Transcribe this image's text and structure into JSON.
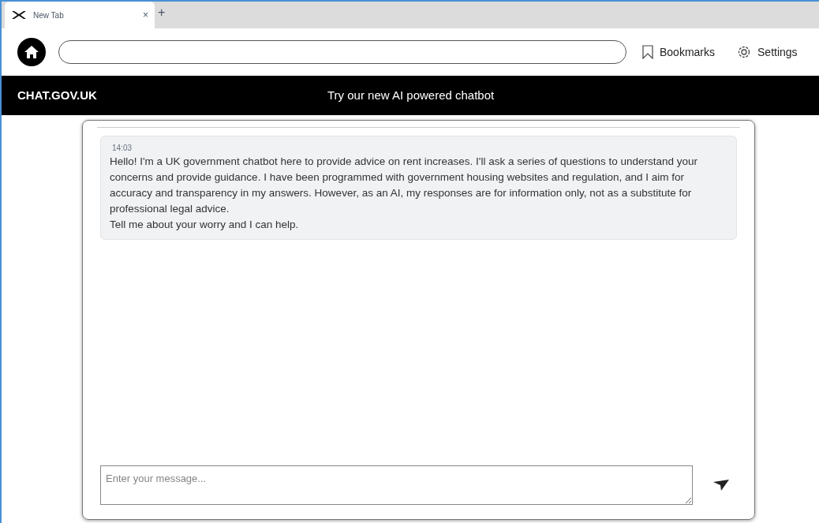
{
  "tabs": [
    {
      "label": "New Tab",
      "selected": true,
      "close": "×"
    }
  ],
  "new_tab": "+",
  "toolbar": {
    "links": [
      {
        "kind": "bookmarks",
        "label": "Bookmarks"
      },
      {
        "kind": "settings",
        "label": "Settings"
      }
    ]
  },
  "banner": {
    "brand": "CHAT.GOV.UK",
    "tagline": "Try our new AI powered chatbot"
  },
  "messages": [
    {
      "time": "14:03",
      "lines": [
        "Hello! I'm a UK government chatbot here to provide advice on rent increases. I'll ask a series of questions to understand your concerns and provide guidance. I have been programmed with government housing websites and regulation, and I aim for accuracy and transparency in my answers. However, as an AI, my responses are for information only, not as a substitute for professional legal advice.",
        "Tell me about your worry and I can help."
      ]
    }
  ],
  "composer": {
    "placeholder": "Enter your message..."
  }
}
